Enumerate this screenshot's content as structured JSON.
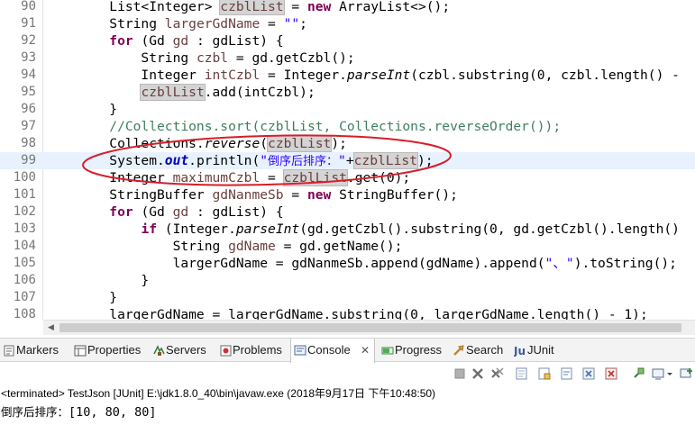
{
  "editor": {
    "lines": [
      {
        "num": "90",
        "tokens": [
          {
            "t": "        List<Integer> "
          },
          {
            "t": "czblList",
            "c": "var occ"
          },
          {
            "t": " = "
          },
          {
            "t": "new",
            "c": "kw"
          },
          {
            "t": " ArrayList<>();"
          }
        ]
      },
      {
        "num": "91",
        "tokens": [
          {
            "t": "        String "
          },
          {
            "t": "largerGdName",
            "c": "var"
          },
          {
            "t": " = "
          },
          {
            "t": "\"\"",
            "c": "str"
          },
          {
            "t": ";"
          }
        ]
      },
      {
        "num": "92",
        "tokens": [
          {
            "t": "        "
          },
          {
            "t": "for",
            "c": "kw"
          },
          {
            "t": " (Gd "
          },
          {
            "t": "gd",
            "c": "var"
          },
          {
            "t": " : gdList) {"
          }
        ]
      },
      {
        "num": "93",
        "tokens": [
          {
            "t": "            String "
          },
          {
            "t": "czbl",
            "c": "var"
          },
          {
            "t": " = gd.getCzbl();"
          }
        ]
      },
      {
        "num": "94",
        "tokens": [
          {
            "t": "            Integer "
          },
          {
            "t": "intCzbl",
            "c": "var"
          },
          {
            "t": " = Integer."
          },
          {
            "t": "parseInt",
            "c": "it"
          },
          {
            "t": "(czbl.substring(0, czbl.length() -"
          }
        ]
      },
      {
        "num": "95",
        "tokens": [
          {
            "t": "            "
          },
          {
            "t": "czblList",
            "c": "var occ"
          },
          {
            "t": ".add(intCzbl);"
          }
        ]
      },
      {
        "num": "96",
        "tokens": [
          {
            "t": "        }"
          }
        ]
      },
      {
        "num": "97",
        "tokens": [
          {
            "t": "        //Collections.sort(czblList, Collections.reverseOrder());",
            "c": "cmt"
          }
        ]
      },
      {
        "num": "98",
        "tokens": [
          {
            "t": "        Collections."
          },
          {
            "t": "reverse",
            "c": "it"
          },
          {
            "t": "("
          },
          {
            "t": "czblList",
            "c": "var occ"
          },
          {
            "t": ");"
          }
        ]
      },
      {
        "num": "99",
        "current": true,
        "tokens": [
          {
            "t": "        System."
          },
          {
            "t": "out",
            "c": "field"
          },
          {
            "t": ".println("
          },
          {
            "t": "\"",
            "c": "str"
          },
          {
            "t": "倒序后排序：",
            "c": "str cjk"
          },
          {
            "t": "\"",
            "c": "str"
          },
          {
            "t": "+"
          },
          {
            "t": "czblList",
            "c": "var occ"
          },
          {
            "t": ");"
          }
        ]
      },
      {
        "num": "100",
        "tokens": [
          {
            "t": "        Integer "
          },
          {
            "t": "maximumCzbl",
            "c": "var"
          },
          {
            "t": " = "
          },
          {
            "t": "czblList",
            "c": "var occ"
          },
          {
            "t": ".get(0);"
          }
        ]
      },
      {
        "num": "101",
        "tokens": [
          {
            "t": "        StringBuffer "
          },
          {
            "t": "gdNanmeSb",
            "c": "var"
          },
          {
            "t": " = "
          },
          {
            "t": "new",
            "c": "kw"
          },
          {
            "t": " StringBuffer();"
          }
        ]
      },
      {
        "num": "102",
        "tokens": [
          {
            "t": "        "
          },
          {
            "t": "for",
            "c": "kw"
          },
          {
            "t": " (Gd "
          },
          {
            "t": "gd",
            "c": "var"
          },
          {
            "t": " : gdList) {"
          }
        ]
      },
      {
        "num": "103",
        "tokens": [
          {
            "t": "            "
          },
          {
            "t": "if",
            "c": "kw"
          },
          {
            "t": " (Integer."
          },
          {
            "t": "parseInt",
            "c": "it"
          },
          {
            "t": "(gd.getCzbl().substring(0, gd.getCzbl().length()"
          }
        ]
      },
      {
        "num": "104",
        "tokens": [
          {
            "t": "                String "
          },
          {
            "t": "gdName",
            "c": "var"
          },
          {
            "t": " = gd.getName();"
          }
        ]
      },
      {
        "num": "105",
        "tokens": [
          {
            "t": "                largerGdName = gdNanmeSb.append(gdName).append("
          },
          {
            "t": "\"、\"",
            "c": "str"
          },
          {
            "t": ").toString();"
          }
        ]
      },
      {
        "num": "106",
        "tokens": [
          {
            "t": "            }"
          }
        ]
      },
      {
        "num": "107",
        "tokens": [
          {
            "t": "        }"
          }
        ]
      },
      {
        "num": "108",
        "tokens": [
          {
            "t": "        largerGdName = largerGdName.substring(0, largerGdName.length() - 1);"
          }
        ]
      }
    ]
  },
  "tabs": [
    {
      "label": "Markers",
      "icon": "markers-icon",
      "active": false
    },
    {
      "label": "Properties",
      "icon": "properties-icon",
      "active": false
    },
    {
      "label": "Servers",
      "icon": "servers-icon",
      "active": false
    },
    {
      "label": "Problems",
      "icon": "problems-icon",
      "active": false
    },
    {
      "label": "Console",
      "icon": "console-icon",
      "active": true,
      "close": "✕"
    },
    {
      "label": "Progress",
      "icon": "progress-icon",
      "active": false
    },
    {
      "label": "Search",
      "icon": "search-icon",
      "active": false
    },
    {
      "label": "JUnit",
      "icon": "junit-icon",
      "active": false
    }
  ],
  "scroll_left_glyph": "◀",
  "console": {
    "header": "<terminated> TestJson [JUnit] E:\\jdk1.8.0_40\\bin\\javaw.exe (2018年9月17日 下午10:48:50)",
    "output_label": "倒序后排序：",
    "output_value": "[10, 80, 80]"
  },
  "colors": {
    "keyword": "#7f0055",
    "string": "#2a00ff",
    "comment": "#3f7f5f",
    "field": "#0000c0",
    "variable": "#6a3e3e",
    "annotation": "#d61e2a",
    "current_line": "#e8f2fe"
  }
}
